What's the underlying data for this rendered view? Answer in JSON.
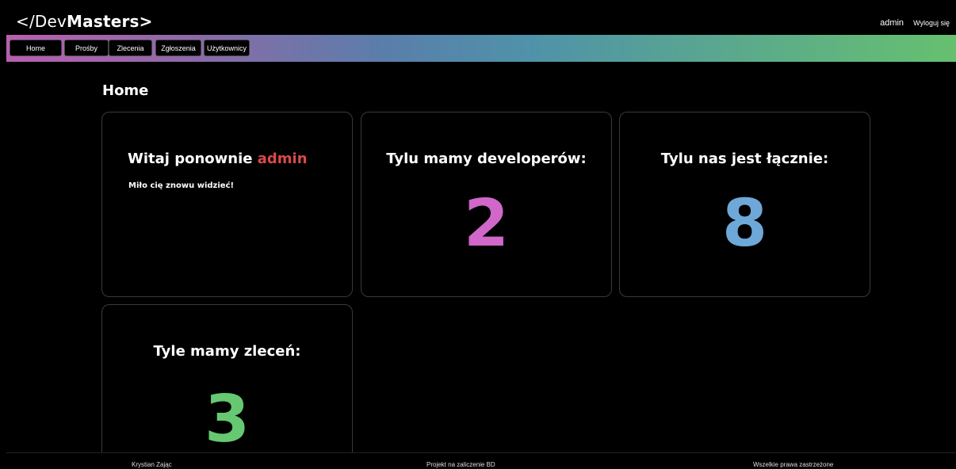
{
  "header": {
    "logo_prefix": "</Dev",
    "logo_bold": "Masters>",
    "user_name": "admin",
    "logout_label": "Wyloguj się"
  },
  "nav": {
    "items": [
      {
        "label": "Home"
      },
      {
        "label": "Prośby"
      },
      {
        "label": "Zlecenia"
      },
      {
        "label": "Zgłoszenia"
      },
      {
        "label": "Użytkownicy"
      }
    ],
    "gradient_colors": [
      "#b95fb0",
      "#5a7eaa",
      "#66c06f"
    ]
  },
  "main": {
    "title": "Home",
    "welcome": {
      "greeting": "Witaj ponownie",
      "name": "admin",
      "subtitle": "Miło cię znowu widzieć!"
    },
    "stats": [
      {
        "label": "Tylu mamy developerów:",
        "value": "2",
        "color": "#d067c9"
      },
      {
        "label": "Tylu nas jest łącznie:",
        "value": "8",
        "color": "#6ea8d8"
      },
      {
        "label": "Tyle mamy zleceń:",
        "value": "3",
        "color": "#66c870"
      }
    ]
  },
  "footer": {
    "author": "Krystian Zając",
    "project": "Projekt na zaliczenie BD",
    "rights": "Wszelkie prawa zastrzeżone"
  }
}
